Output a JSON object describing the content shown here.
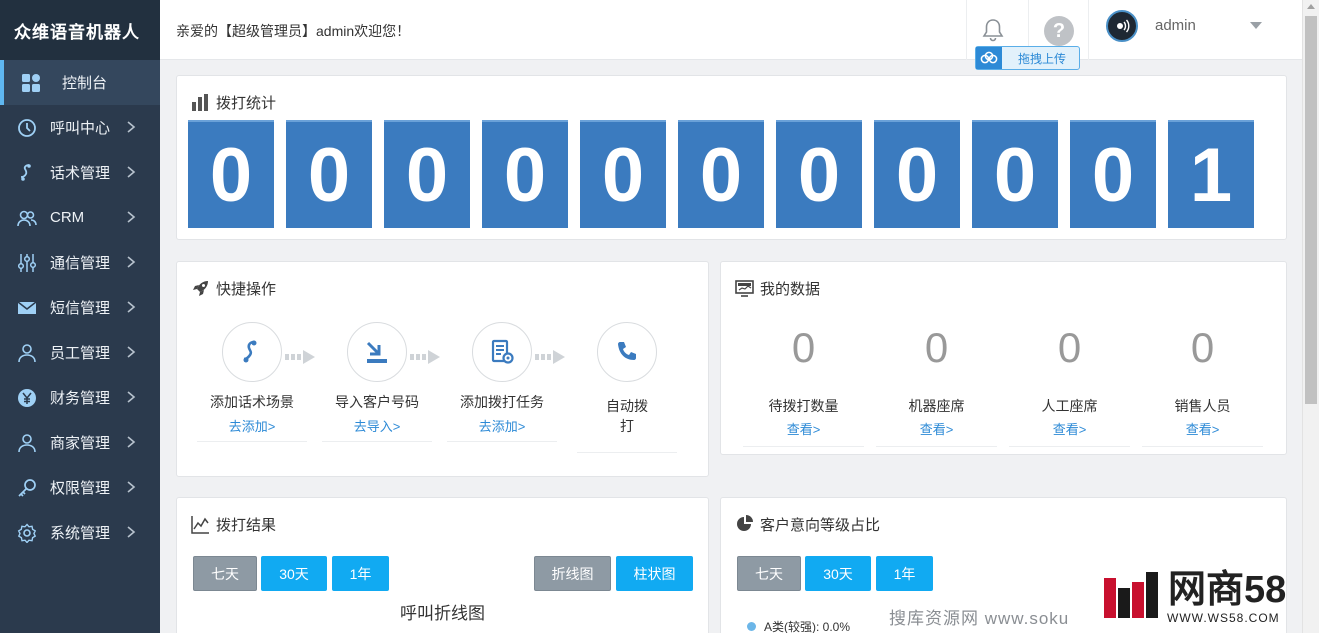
{
  "brand": {
    "title": "众维语音机器人"
  },
  "sidebar": {
    "items": [
      {
        "label": "控制台",
        "icon": "dashboard-icon"
      },
      {
        "label": "呼叫中心",
        "icon": "clock-icon"
      },
      {
        "label": "话术管理",
        "icon": "script-icon"
      },
      {
        "label": "CRM",
        "icon": "users-icon"
      },
      {
        "label": "通信管理",
        "icon": "sliders-icon"
      },
      {
        "label": "短信管理",
        "icon": "mail-icon"
      },
      {
        "label": "员工管理",
        "icon": "person-icon"
      },
      {
        "label": "财务管理",
        "icon": "yuan-icon"
      },
      {
        "label": "商家管理",
        "icon": "person-icon"
      },
      {
        "label": "权限管理",
        "icon": "key-icon"
      },
      {
        "label": "系统管理",
        "icon": "gear-icon"
      }
    ]
  },
  "header": {
    "welcome": "亲爱的【超级管理员】admin欢迎您！",
    "username": "admin",
    "help_symbol": "?",
    "upload_label": "拖拽上传"
  },
  "stats": {
    "title": "拨打统计",
    "digits": [
      "0",
      "0",
      "0",
      "0",
      "0",
      "0",
      "0",
      "0",
      "0",
      "0",
      "1"
    ]
  },
  "quick": {
    "title": "快捷操作",
    "steps": [
      {
        "label": "添加话术场景",
        "link": "去添加>"
      },
      {
        "label": "导入客户号码",
        "link": "去导入>"
      },
      {
        "label": "添加拨打任务",
        "link": "去添加>"
      },
      {
        "label": "自动拨打",
        "link": ""
      }
    ]
  },
  "mydata": {
    "title": "我的数据",
    "items": [
      {
        "value": "0",
        "label": "待拨打数量",
        "link": "查看>"
      },
      {
        "value": "0",
        "label": "机器座席",
        "link": "查看>"
      },
      {
        "value": "0",
        "label": "人工座席",
        "link": "查看>"
      },
      {
        "value": "0",
        "label": "销售人员",
        "link": "查看>"
      }
    ]
  },
  "result": {
    "title": "拨打结果",
    "ranges": [
      "七天",
      "30天",
      "1年"
    ],
    "chart_types": [
      "折线图",
      "柱状图"
    ],
    "chart_title": "呼叫折线图"
  },
  "intent": {
    "title": "客户意向等级占比",
    "ranges": [
      "七天",
      "30天",
      "1年"
    ],
    "legend_first": "A类(较强): 0.0%"
  },
  "watermark": {
    "text": "搜库资源网  www.soku",
    "logo_name": "网商58",
    "logo_url": "WWW.WS58.COM"
  },
  "colors": {
    "sidebar_bg": "#2b3a4d",
    "digit_bg": "#3b7bbf",
    "button_blue": "#11aaf2",
    "button_gray": "#8e9aa4",
    "link": "#2d8ad6"
  }
}
